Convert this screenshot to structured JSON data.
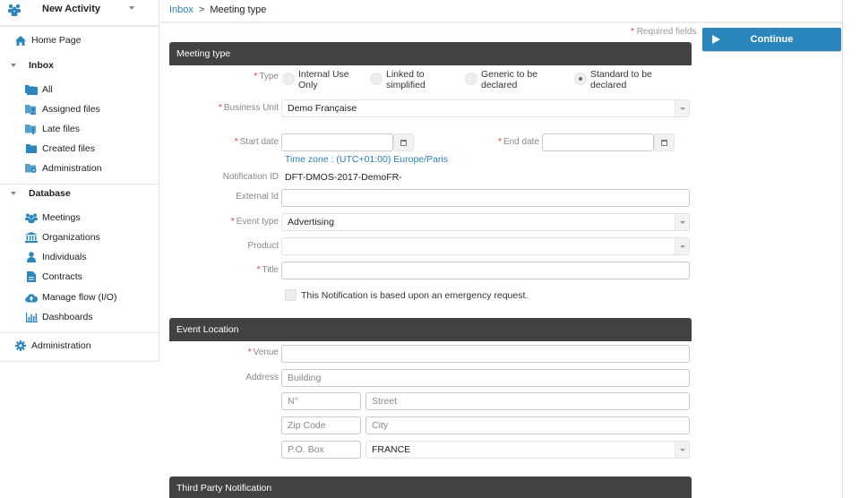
{
  "sidebar": {
    "title": "New Activity",
    "home": "Home Page",
    "inbox": {
      "label": "Inbox",
      "items": [
        "All",
        "Assigned files",
        "Late files",
        "Created files",
        "Administration"
      ]
    },
    "database": {
      "label": "Database",
      "items": [
        "Meetings",
        "Organizations",
        "Individuals",
        "Contracts",
        "Manage flow (I/O)",
        "Dashboards"
      ]
    },
    "admin": "Administration"
  },
  "breadcrumb": {
    "parent": "Inbox",
    "separator": ">",
    "current": "Meeting type"
  },
  "required_note": "Required fields",
  "required_star": "*",
  "continue_label": "Continue",
  "colors": {
    "accent": "#2a86bd",
    "section_header": "#424242",
    "link": "#2b7fb8",
    "required": "#e53935"
  },
  "meeting_type": {
    "header": "Meeting type",
    "type_label": "Type",
    "type_options": [
      {
        "label": "Internal Use Only",
        "line1": "Internal Use",
        "line2": "Only",
        "selected": false
      },
      {
        "label": "Linked to simplified",
        "line1": "Linked to",
        "line2": "simplified",
        "selected": false
      },
      {
        "label": "Generic to be declared",
        "line1": "Generic to be",
        "line2": "declared",
        "selected": false
      },
      {
        "label": "Standard to be declared",
        "line1": "Standard to be",
        "line2": "declared",
        "selected": true
      }
    ],
    "business_unit_label": "Business Unit",
    "business_unit_value": "Demo Française",
    "start_date_label": "Start date",
    "start_date_value": "",
    "end_date_label": "End date",
    "end_date_value": "",
    "timezone": "Time zone : (UTC+01:00) Europe/Paris",
    "notification_id_label": "Notification ID",
    "notification_id_value": "DFT-DMOS-2017-DemoFR-",
    "external_id_label": "External Id",
    "external_id_value": "",
    "event_type_label": "Event type",
    "event_type_value": "Advertising",
    "product_label": "Product",
    "product_value": "",
    "title_label": "Title",
    "title_value": "",
    "emergency_label": "This Notification is based upon an emergency request.",
    "emergency_checked": false
  },
  "event_location": {
    "header": "Event Location",
    "venue_label": "Venue",
    "venue_value": "",
    "address_label": "Address",
    "building_placeholder": "Building",
    "number_placeholder": "N°",
    "street_placeholder": "Street",
    "zip_placeholder": "Zip Code",
    "city_placeholder": "City",
    "pobox_placeholder": "P.O. Box",
    "country_value": "FRANCE"
  },
  "third_party": {
    "header": "Third Party Notification"
  }
}
